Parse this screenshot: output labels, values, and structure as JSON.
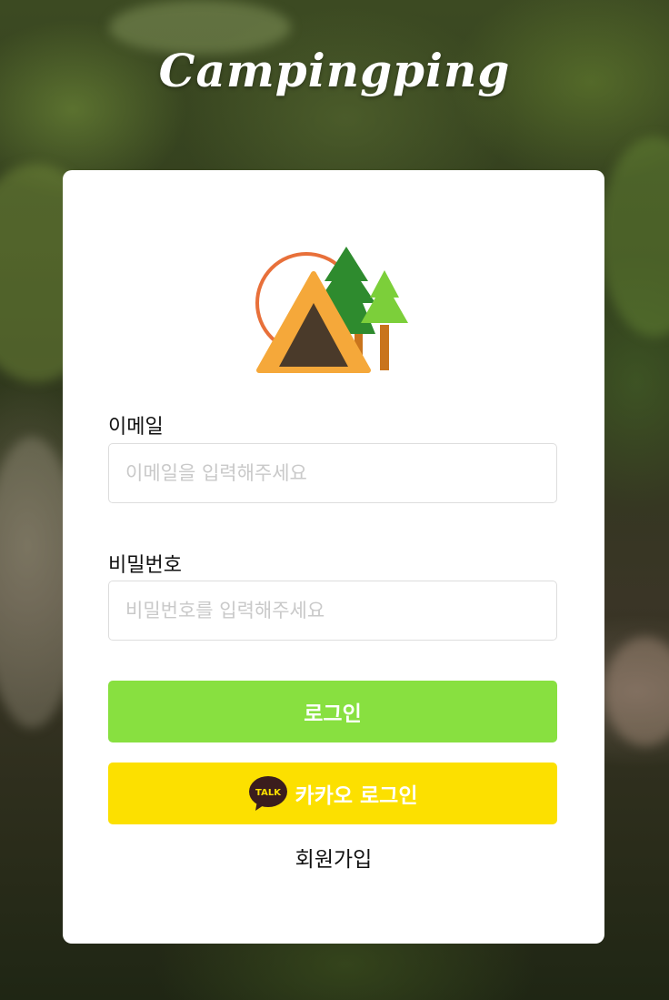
{
  "app": {
    "title": "Campingping"
  },
  "form": {
    "email_label": "이메일",
    "email_placeholder": "이메일을 입력해주세요",
    "email_value": "",
    "password_label": "비밀번호",
    "password_placeholder": "비밀번호를 입력해주세요",
    "password_value": ""
  },
  "buttons": {
    "login_label": "로그인",
    "kakao_label": "카카오 로그인",
    "kakao_icon_text": "TALK",
    "signup_label": "회원가입"
  },
  "colors": {
    "login_button": "#88e040",
    "kakao_button": "#fce000",
    "logo_orange": "#f5a83a",
    "logo_circle": "#e8703a",
    "logo_tree_dark": "#2e8b2e",
    "logo_tree_light": "#7ccf3a"
  },
  "icons": {
    "logo": "camping-tent-trees-icon",
    "kakao": "kakao-talk-icon"
  }
}
